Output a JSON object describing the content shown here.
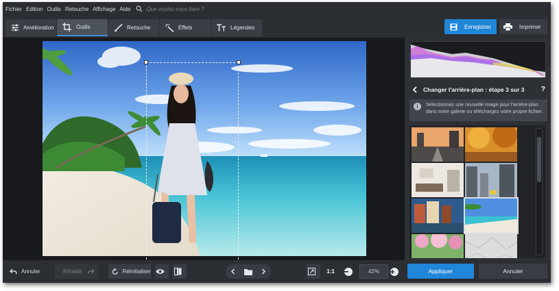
{
  "menu": {
    "items": [
      "Fichier",
      "Edition",
      "Outils",
      "Retouche",
      "Affichage",
      "Aide"
    ],
    "search_placeholder": "Que voulez-vous faire ?"
  },
  "toolbar": {
    "tabs": [
      {
        "label": "Amélioration",
        "icon": "sliders-icon"
      },
      {
        "label": "Outils",
        "icon": "crop-icon",
        "active": true
      },
      {
        "label": "Retouche",
        "icon": "brush-icon"
      },
      {
        "label": "Effets",
        "icon": "magic-wand-icon"
      },
      {
        "label": "Légendes",
        "icon": "text-icon"
      }
    ],
    "save_label": "Enregistrer",
    "print_label": "Imprimer"
  },
  "panel": {
    "step_title": "Changer l'arrière-plan : étape 3 sur 3",
    "help": "?",
    "info_text": "Sélectionnez une nouvelle image pour l'arrière-plan dans notre galerie ou téléchargez votre propre fichier.",
    "gallery": [
      {
        "name": "city-street-sunset-thumbnail"
      },
      {
        "name": "autumn-park-thumbnail"
      },
      {
        "name": "living-room-interior-thumbnail"
      },
      {
        "name": "city-skyscrapers-thumbnail"
      },
      {
        "name": "canal-town-houses-thumbnail"
      },
      {
        "name": "tropical-beach-thumbnail",
        "selected": true
      },
      {
        "name": "blossom-garden-thumbnail"
      },
      {
        "name": "crumpled-paper-thumbnail"
      }
    ]
  },
  "bottom": {
    "undo_label": "Annuler",
    "redo_label": "Rétablir",
    "reset_label": "Réinitialiser",
    "one_to_one": "1:1",
    "zoom_value": "42%",
    "apply_label": "Appliquer",
    "cancel_label": "Annuler"
  },
  "colors": {
    "accent": "#1f86d8",
    "background": "#2b2e33"
  }
}
